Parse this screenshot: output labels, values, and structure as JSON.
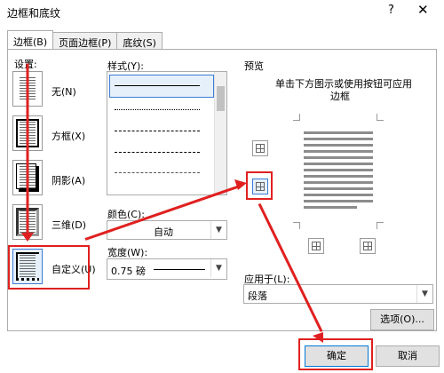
{
  "window": {
    "title": "边框和底纹",
    "help": "?",
    "close": "✕"
  },
  "tabs": [
    {
      "label": "边框(B)"
    },
    {
      "label": "页面边框(P)"
    },
    {
      "label": "底纹(S)"
    }
  ],
  "settings": {
    "heading": "设置:",
    "items": [
      {
        "label": "无(N)"
      },
      {
        "label": "方框(X)"
      },
      {
        "label": "阴影(A)"
      },
      {
        "label": "三维(D)"
      },
      {
        "label": "自定义(U)"
      }
    ]
  },
  "style": {
    "label": "样式(Y):"
  },
  "color": {
    "label": "颜色(C):",
    "value": "自动"
  },
  "width": {
    "label": "宽度(W):",
    "value": "0.75 磅"
  },
  "preview": {
    "heading": "预览",
    "hint": "单击下方图示或使用按钮可应用",
    "hint2": "边框"
  },
  "apply_to": {
    "label": "应用于(L):",
    "value": "段落"
  },
  "buttons": {
    "options": "选项(O)...",
    "ok": "确定",
    "cancel": "取消"
  },
  "colors": {
    "annotation": "#e02020",
    "accent": "#3a7bd5"
  }
}
